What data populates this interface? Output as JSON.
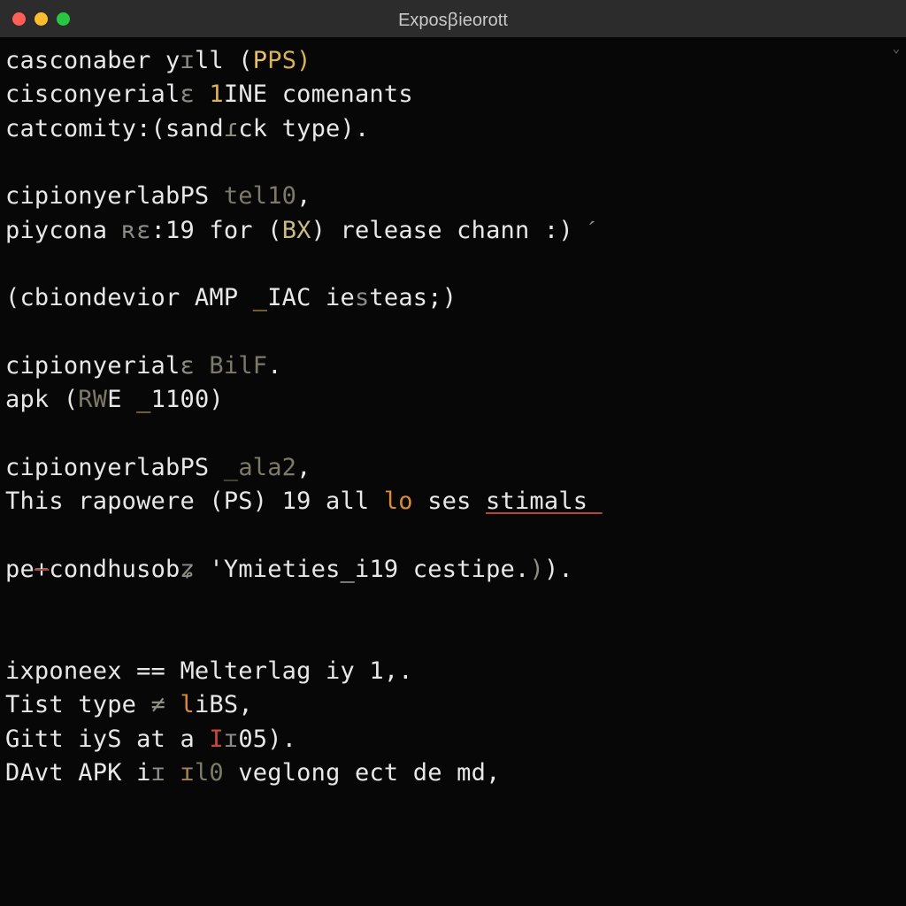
{
  "window": {
    "title": "Exposꞵieorott"
  },
  "lines": [
    [
      {
        "t": "casconaber y",
        "cls": "c-default"
      },
      {
        "t": "ɪ",
        "cls": "c-dim"
      },
      {
        "t": "ll (",
        "cls": "c-default"
      },
      {
        "t": "P",
        "cls": "c-goldbr"
      },
      {
        "t": "PS)",
        "cls": "c-gold"
      }
    ],
    [
      {
        "t": "cisconyerial",
        "cls": "c-default"
      },
      {
        "t": "ɛ",
        "cls": "c-dim"
      },
      {
        "t": " ",
        "cls": "c-default"
      },
      {
        "t": "1",
        "cls": "c-gold"
      },
      {
        "t": "INE comenants",
        "cls": "c-default"
      }
    ],
    [
      {
        "t": "catcomity:(sand",
        "cls": "c-default"
      },
      {
        "t": "ɾ",
        "cls": "c-dim"
      },
      {
        "t": "ck type).",
        "cls": "c-default"
      }
    ],
    [],
    [
      {
        "t": "cipionyerlabPS ",
        "cls": "c-default"
      },
      {
        "t": "tel10",
        "cls": "c-dim2"
      },
      {
        "t": ",",
        "cls": "c-default"
      }
    ],
    [
      {
        "t": "piycona ",
        "cls": "c-default"
      },
      {
        "t": "ʀɛ",
        "cls": "c-dim"
      },
      {
        "t": ":19 for (",
        "cls": "c-default"
      },
      {
        "t": "BX",
        "cls": "c-khaki"
      },
      {
        "t": ") release chann :) ",
        "cls": "c-default"
      },
      {
        "t": "ˊ",
        "cls": "c-dim"
      }
    ],
    [],
    [
      {
        "t": "(cbiondevior AMP ",
        "cls": "c-default"
      },
      {
        "t": "_",
        "cls": "c-gold"
      },
      {
        "t": "IAC ie",
        "cls": "c-default"
      },
      {
        "t": "s",
        "cls": "c-dim"
      },
      {
        "t": "teas;)",
        "cls": "c-default"
      }
    ],
    [],
    [
      {
        "t": "cipionyerial",
        "cls": "c-default"
      },
      {
        "t": "ɛ",
        "cls": "c-dim"
      },
      {
        "t": " ",
        "cls": "c-default"
      },
      {
        "t": "BilF",
        "cls": "c-dim2"
      },
      {
        "t": ".",
        "cls": "c-default"
      }
    ],
    [
      {
        "t": "apk (",
        "cls": "c-default"
      },
      {
        "t": "RW",
        "cls": "c-dim2"
      },
      {
        "t": "E ",
        "cls": "c-default"
      },
      {
        "t": "_",
        "cls": "c-gold"
      },
      {
        "t": "1100)",
        "cls": "c-default"
      }
    ],
    [],
    [
      {
        "t": "cipionyerlabPS ",
        "cls": "c-default"
      },
      {
        "t": "_",
        "cls": "c-dim2"
      },
      {
        "t": "ala2",
        "cls": "c-dim2"
      },
      {
        "t": ",",
        "cls": "c-default"
      }
    ],
    [
      {
        "t": "This rapowere (PS) 19 all ",
        "cls": "c-default"
      },
      {
        "t": "lo",
        "cls": "c-orange"
      },
      {
        "t": " ses ",
        "cls": "c-default"
      },
      {
        "t": "stimals ",
        "cls": "c-default c-underline"
      }
    ],
    [],
    [
      {
        "t": "pe",
        "cls": "c-default"
      },
      {
        "t": "+",
        "cls": "c-strike c-default"
      },
      {
        "t": "condhusob",
        "cls": "c-default"
      },
      {
        "t": "ʑ",
        "cls": "c-dim"
      },
      {
        "t": " '",
        "cls": "c-default"
      },
      {
        "t": "Ymieties_i19 cestipe.",
        "cls": "c-default"
      },
      {
        "t": ")",
        "cls": "c-dim"
      },
      {
        "t": ").",
        "cls": "c-default"
      }
    ],
    [],
    [],
    [
      {
        "t": "ixponeex == Melterlag iy 1,.",
        "cls": "c-default"
      }
    ],
    [
      {
        "t": "Tist type ",
        "cls": "c-default"
      },
      {
        "t": "≠",
        "cls": "c-dim"
      },
      {
        "t": " ",
        "cls": "c-default"
      },
      {
        "t": "l",
        "cls": "c-orange"
      },
      {
        "t": "iBS,",
        "cls": "c-default"
      }
    ],
    [
      {
        "t": "Gitt iyS at a ",
        "cls": "c-default"
      },
      {
        "t": "I",
        "cls": "c-red"
      },
      {
        "t": "ɪ",
        "cls": "c-dim"
      },
      {
        "t": "05).",
        "cls": "c-default"
      }
    ],
    [
      {
        "t": "DAvt APK i",
        "cls": "c-default"
      },
      {
        "t": "ɪ",
        "cls": "c-dim"
      },
      {
        "t": " ",
        "cls": "c-default"
      },
      {
        "t": "ɪ",
        "cls": "c-brown"
      },
      {
        "t": "l0",
        "cls": "c-dim2"
      },
      {
        "t": " veglong ect de md,",
        "cls": "c-default"
      }
    ]
  ]
}
